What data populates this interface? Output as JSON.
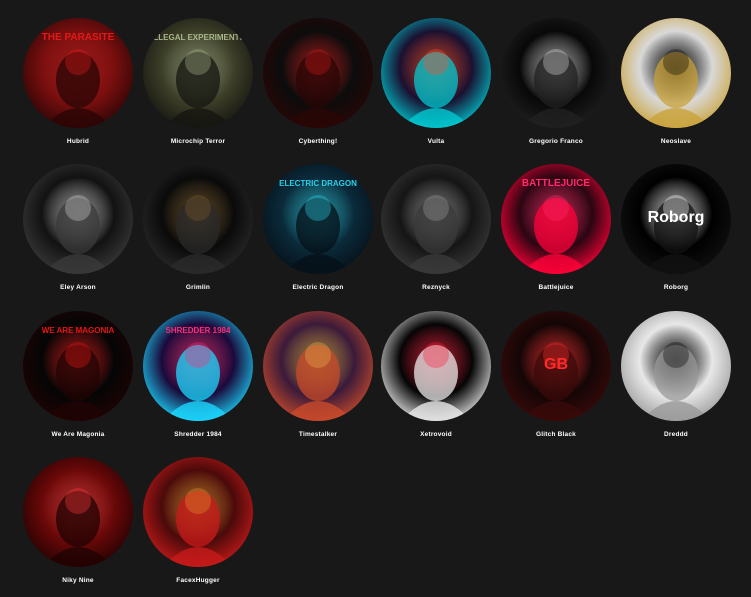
{
  "artists": [
    {
      "name": "Hubrid",
      "art_text": "THE PARASITE",
      "palette": [
        "#7a0f0f",
        "#e01a1a",
        "#2a0505"
      ]
    },
    {
      "name": "Microchip Terror",
      "art_text": "ILLEGAL EXPERIMENTS",
      "palette": [
        "#3d3f28",
        "#a9b58a",
        "#151510"
      ]
    },
    {
      "name": "Cyberthing!",
      "art_text": "",
      "palette": [
        "#0c0c0c",
        "#c81818",
        "#2a0606"
      ]
    },
    {
      "name": "Vulta",
      "art_text": "",
      "palette": [
        "#1a1030",
        "#ff4a2a",
        "#00c8d0"
      ]
    },
    {
      "name": "Gregorio Franco",
      "art_text": "",
      "palette": [
        "#080808",
        "#d8d8d8",
        "#202020"
      ]
    },
    {
      "name": "Neoslave",
      "art_text": "",
      "palette": [
        "#d9d9d9",
        "#0c0c0c",
        "#c9a23a"
      ]
    },
    {
      "name": "Eley Arson",
      "art_text": "",
      "palette": [
        "#121212",
        "#d0d0d0",
        "#3a3a3a"
      ]
    },
    {
      "name": "Grimlin",
      "art_text": "",
      "palette": [
        "#0a0a0a",
        "#7a5a2a",
        "#2a2a2a"
      ]
    },
    {
      "name": "Electric Dragon",
      "art_text": "ELECTRIC DRAGON",
      "palette": [
        "#0a2a3a",
        "#2ad0e8",
        "#061018"
      ]
    },
    {
      "name": "Reznyck",
      "art_text": "",
      "palette": [
        "#151515",
        "#9a9a9a",
        "#3a3a3a"
      ]
    },
    {
      "name": "Battlejuice",
      "art_text": "BATTLEJUICE",
      "palette": [
        "#2a0612",
        "#ff2a6a",
        "#ff0038"
      ]
    },
    {
      "name": "Roborg",
      "art_text": "Roborg",
      "palette": [
        "#000000",
        "#ffffff",
        "#111111"
      ]
    },
    {
      "name": "We Are Magonia",
      "art_text": "WE ARE MAGONIA",
      "palette": [
        "#050505",
        "#e61414",
        "#200404"
      ]
    },
    {
      "name": "Shredder 1984",
      "art_text": "SHREDDER 1984",
      "palette": [
        "#1a0a3a",
        "#ff2a7a",
        "#1ad8ff"
      ]
    },
    {
      "name": "Timestalker",
      "art_text": "",
      "palette": [
        "#3a1a3a",
        "#e8b04a",
        "#c84a2a"
      ]
    },
    {
      "name": "Xetrovoid",
      "art_text": "",
      "palette": [
        "#050505",
        "#ff1a3a",
        "#e8e8e8"
      ]
    },
    {
      "name": "Glitch Black",
      "art_text": "GB",
      "palette": [
        "#140606",
        "#ff2a2a",
        "#3a0a0a"
      ]
    },
    {
      "name": "Dreddd",
      "art_text": "",
      "palette": [
        "#e8e8e8",
        "#0a0a0a",
        "#9a9a9a"
      ]
    },
    {
      "name": "Niky Nine",
      "art_text": "",
      "palette": [
        "#6a0808",
        "#ff3a3a",
        "#200202"
      ]
    },
    {
      "name": "FacexHugger",
      "art_text": "",
      "palette": [
        "#4a0a0a",
        "#e8902a",
        "#c81a1a"
      ]
    }
  ]
}
